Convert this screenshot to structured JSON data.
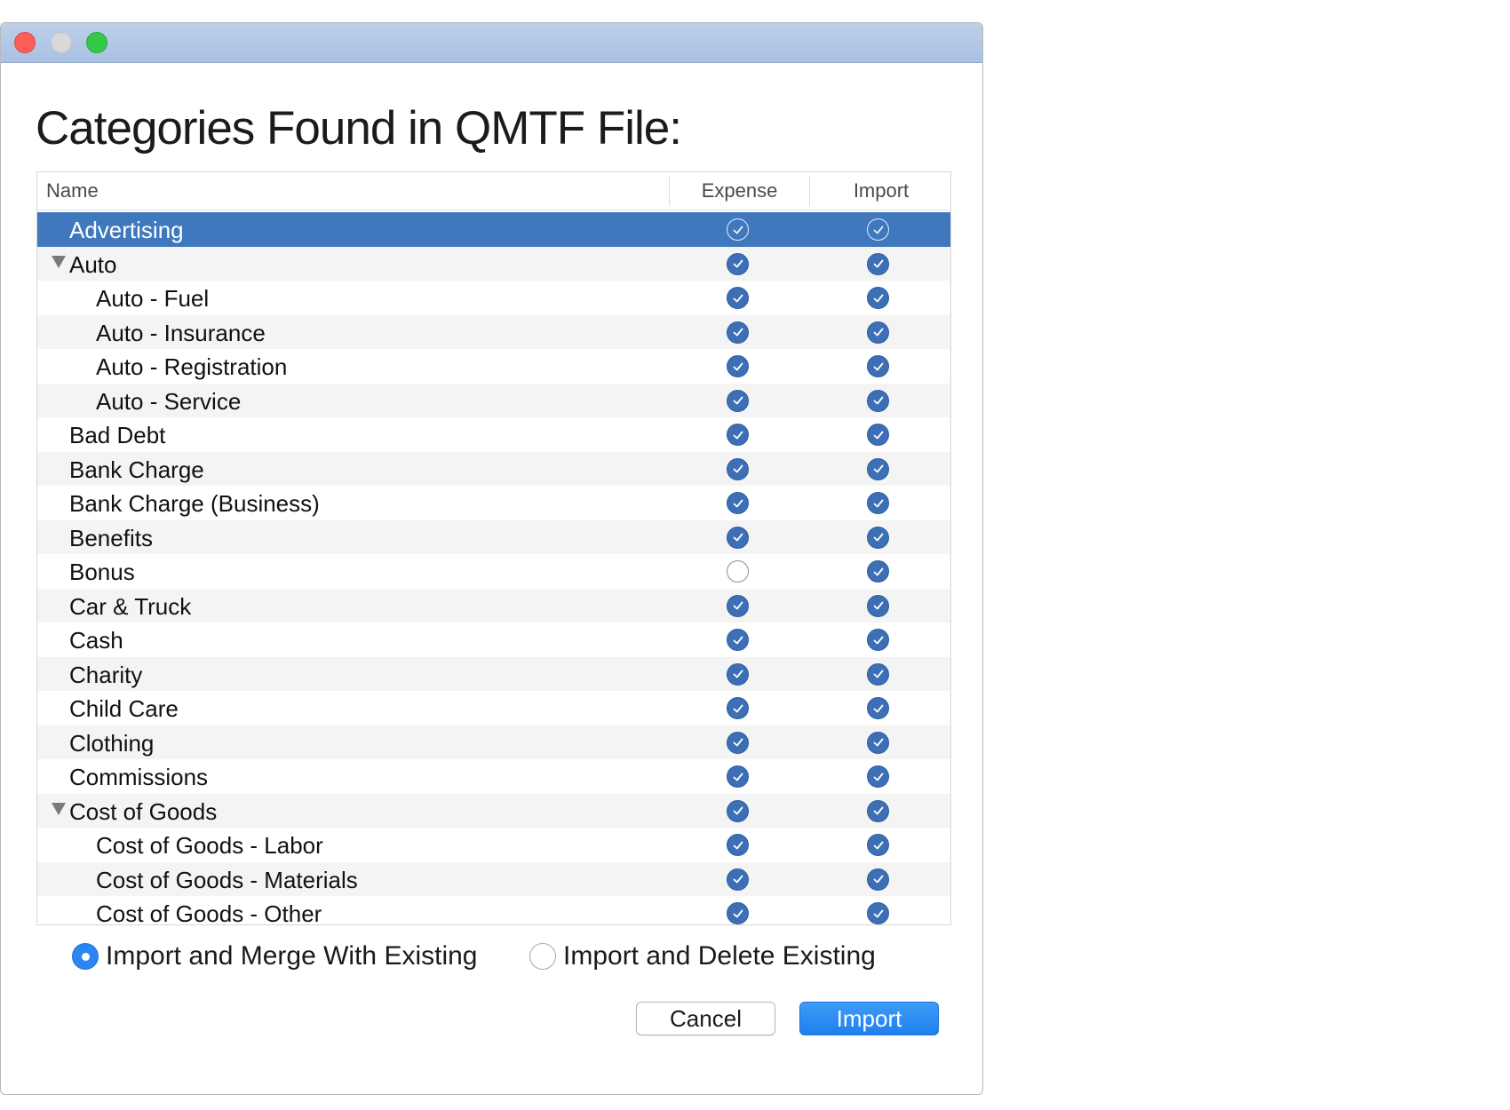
{
  "window": {
    "heading": "Categories Found in QMTF File:"
  },
  "table": {
    "columns": {
      "name": "Name",
      "expense": "Expense",
      "import": "Import"
    },
    "rows": [
      {
        "label": "Advertising",
        "level": 0,
        "expanded": null,
        "expense": true,
        "import": true,
        "selected": true
      },
      {
        "label": "Auto",
        "level": 0,
        "expanded": true,
        "expense": true,
        "import": true,
        "selected": false
      },
      {
        "label": "Auto - Fuel",
        "level": 1,
        "expanded": null,
        "expense": true,
        "import": true,
        "selected": false
      },
      {
        "label": "Auto - Insurance",
        "level": 1,
        "expanded": null,
        "expense": true,
        "import": true,
        "selected": false
      },
      {
        "label": "Auto - Registration",
        "level": 1,
        "expanded": null,
        "expense": true,
        "import": true,
        "selected": false
      },
      {
        "label": "Auto - Service",
        "level": 1,
        "expanded": null,
        "expense": true,
        "import": true,
        "selected": false
      },
      {
        "label": "Bad Debt",
        "level": 0,
        "expanded": null,
        "expense": true,
        "import": true,
        "selected": false
      },
      {
        "label": "Bank Charge",
        "level": 0,
        "expanded": null,
        "expense": true,
        "import": true,
        "selected": false
      },
      {
        "label": "Bank Charge (Business)",
        "level": 0,
        "expanded": null,
        "expense": true,
        "import": true,
        "selected": false
      },
      {
        "label": "Benefits",
        "level": 0,
        "expanded": null,
        "expense": true,
        "import": true,
        "selected": false
      },
      {
        "label": "Bonus",
        "level": 0,
        "expanded": null,
        "expense": false,
        "import": true,
        "selected": false
      },
      {
        "label": "Car & Truck",
        "level": 0,
        "expanded": null,
        "expense": true,
        "import": true,
        "selected": false
      },
      {
        "label": "Cash",
        "level": 0,
        "expanded": null,
        "expense": true,
        "import": true,
        "selected": false
      },
      {
        "label": "Charity",
        "level": 0,
        "expanded": null,
        "expense": true,
        "import": true,
        "selected": false
      },
      {
        "label": "Child Care",
        "level": 0,
        "expanded": null,
        "expense": true,
        "import": true,
        "selected": false
      },
      {
        "label": "Clothing",
        "level": 0,
        "expanded": null,
        "expense": true,
        "import": true,
        "selected": false
      },
      {
        "label": "Commissions",
        "level": 0,
        "expanded": null,
        "expense": true,
        "import": true,
        "selected": false
      },
      {
        "label": "Cost of Goods",
        "level": 0,
        "expanded": true,
        "expense": true,
        "import": true,
        "selected": false
      },
      {
        "label": "Cost of Goods - Labor",
        "level": 1,
        "expanded": null,
        "expense": true,
        "import": true,
        "selected": false
      },
      {
        "label": "Cost of Goods - Materials",
        "level": 1,
        "expanded": null,
        "expense": true,
        "import": true,
        "selected": false
      },
      {
        "label": "Cost of Goods - Other",
        "level": 1,
        "expanded": null,
        "expense": true,
        "import": true,
        "selected": false
      }
    ]
  },
  "options": {
    "merge_label": "Import and Merge With Existing",
    "delete_label": "Import and Delete Existing",
    "selected": "merge"
  },
  "buttons": {
    "cancel_label": "Cancel",
    "import_label": "Import"
  },
  "colors": {
    "selection": "#3f78bd",
    "checkbox": "#3c6fb5",
    "accent": "#2b86f1"
  }
}
